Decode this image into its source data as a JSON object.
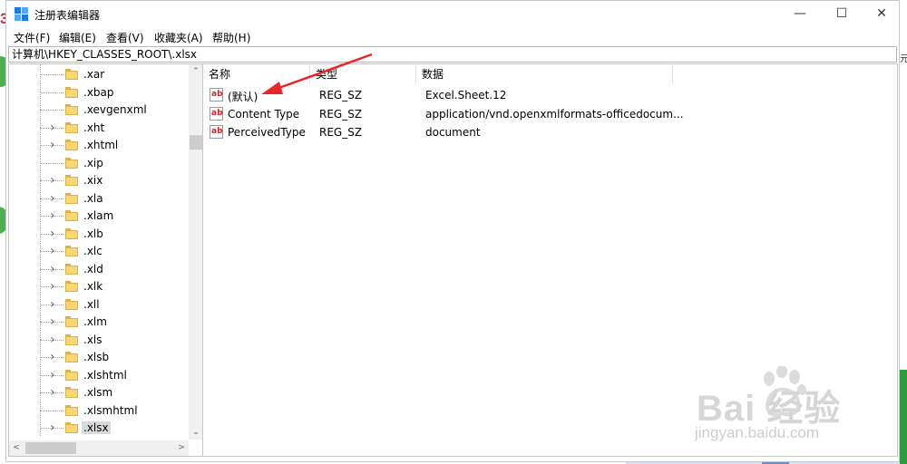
{
  "background": {
    "red_number": "3",
    "right_strip_text": "元"
  },
  "window": {
    "title": "注册表编辑器",
    "controls": {
      "minimize": "—",
      "maximize": "☐",
      "close": "✕"
    },
    "menu": [
      "文件(F)",
      "编辑(E)",
      "查看(V)",
      "收藏夹(A)",
      "帮助(H)"
    ],
    "address": "计算机\\HKEY_CLASSES_ROOT\\.xlsx"
  },
  "tree": {
    "items": [
      {
        "label": ".xar",
        "expandable": false
      },
      {
        "label": ".xbap",
        "expandable": false
      },
      {
        "label": ".xevgenxml",
        "expandable": false
      },
      {
        "label": ".xht",
        "expandable": true
      },
      {
        "label": ".xhtml",
        "expandable": true
      },
      {
        "label": ".xip",
        "expandable": false
      },
      {
        "label": ".xix",
        "expandable": true
      },
      {
        "label": ".xla",
        "expandable": true
      },
      {
        "label": ".xlam",
        "expandable": true
      },
      {
        "label": ".xlb",
        "expandable": true
      },
      {
        "label": ".xlc",
        "expandable": true
      },
      {
        "label": ".xld",
        "expandable": true
      },
      {
        "label": ".xlk",
        "expandable": true
      },
      {
        "label": ".xll",
        "expandable": true
      },
      {
        "label": ".xlm",
        "expandable": true
      },
      {
        "label": ".xls",
        "expandable": true
      },
      {
        "label": ".xlsb",
        "expandable": true
      },
      {
        "label": ".xlshtml",
        "expandable": true
      },
      {
        "label": ".xlsm",
        "expandable": true
      },
      {
        "label": ".xlsmhtml",
        "expandable": false
      },
      {
        "label": ".xlsx",
        "expandable": true,
        "selected": true
      }
    ]
  },
  "list": {
    "columns": [
      "名称",
      "类型",
      "数据"
    ],
    "rows": [
      {
        "name": "(默认)",
        "type": "REG_SZ",
        "data": "Excel.Sheet.12"
      },
      {
        "name": "Content Type",
        "type": "REG_SZ",
        "data": "application/vnd.openxmlformats-officedocum..."
      },
      {
        "name": "PerceivedType",
        "type": "REG_SZ",
        "data": "document"
      }
    ],
    "icon_text": "ab"
  },
  "watermark": {
    "brand": "Bai  经验",
    "url": "jingyan.baidu.com"
  },
  "colors": {
    "arrow": "#e8262a",
    "selection": "#d9d9d9",
    "folder": "#f7d774"
  }
}
